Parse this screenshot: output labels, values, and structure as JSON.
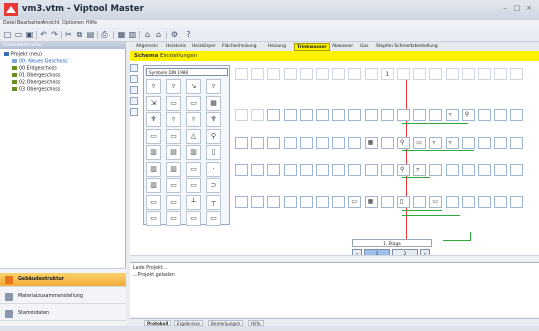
{
  "window": {
    "title": "vm3.vtm - Viptool Master"
  },
  "menu": [
    "Datei",
    "Bearbeiten",
    "Ansicht",
    "Optionen",
    "Hilfe"
  ],
  "sidebar": {
    "header": "Gebäudestruktur",
    "tree": [
      {
        "label": "Projekt (neu)",
        "level": 0
      },
      {
        "label": "00: Neues Geschoss",
        "level": 1
      },
      {
        "label": "00 Erdgeschoss",
        "level": 1
      },
      {
        "label": "01 Obergeschoss",
        "level": 1
      },
      {
        "label": "02 Obergeschoss",
        "level": 1
      },
      {
        "label": "03 Obergeschoss",
        "level": 1
      }
    ],
    "nav": [
      {
        "label": "Gebäudestruktur",
        "active": true
      },
      {
        "label": "Materialzusammenstellung",
        "active": false
      },
      {
        "label": "Stammdaten",
        "active": false
      }
    ]
  },
  "tabs": [
    {
      "label": "Allgemein",
      "active": false
    },
    {
      "label": "Heizkreis",
      "active": false
    },
    {
      "label": "Heizkörper",
      "active": false
    },
    {
      "label": "Flächenheizung",
      "active": false
    },
    {
      "label": "Heizung",
      "active": false
    },
    {
      "label": "Trinkwasser",
      "active": true
    },
    {
      "label": "Abwasser",
      "active": false
    },
    {
      "label": "Gas",
      "active": false
    },
    {
      "label": "Stopfen Schmeltzbestellung",
      "active": false
    }
  ],
  "subtabs": {
    "schema": "Schema",
    "einstellungen": "Einstellungen"
  },
  "palette": {
    "select_value": "Symbole DIN 1988"
  },
  "grid": {
    "cell_top_marker": "1"
  },
  "floor_label": "1. Etage",
  "pager": {
    "prev": "«",
    "page1": "1",
    "page2": "2",
    "next": "»"
  },
  "log": {
    "lines": [
      "Lade Projekt...",
      "...Projekt geladen"
    ]
  },
  "bottom_tabs": [
    {
      "label": "Protokoll",
      "active": true
    },
    {
      "label": "Ergebnisse",
      "active": false
    },
    {
      "label": "Bemerkungen",
      "active": false
    },
    {
      "label": "Hilfe",
      "active": false
    }
  ],
  "colors": {
    "accent": "#fff200",
    "nav_active": "#f2a93c",
    "pipe_green": "#2eaa3a",
    "pipe_red": "#ee3333"
  }
}
